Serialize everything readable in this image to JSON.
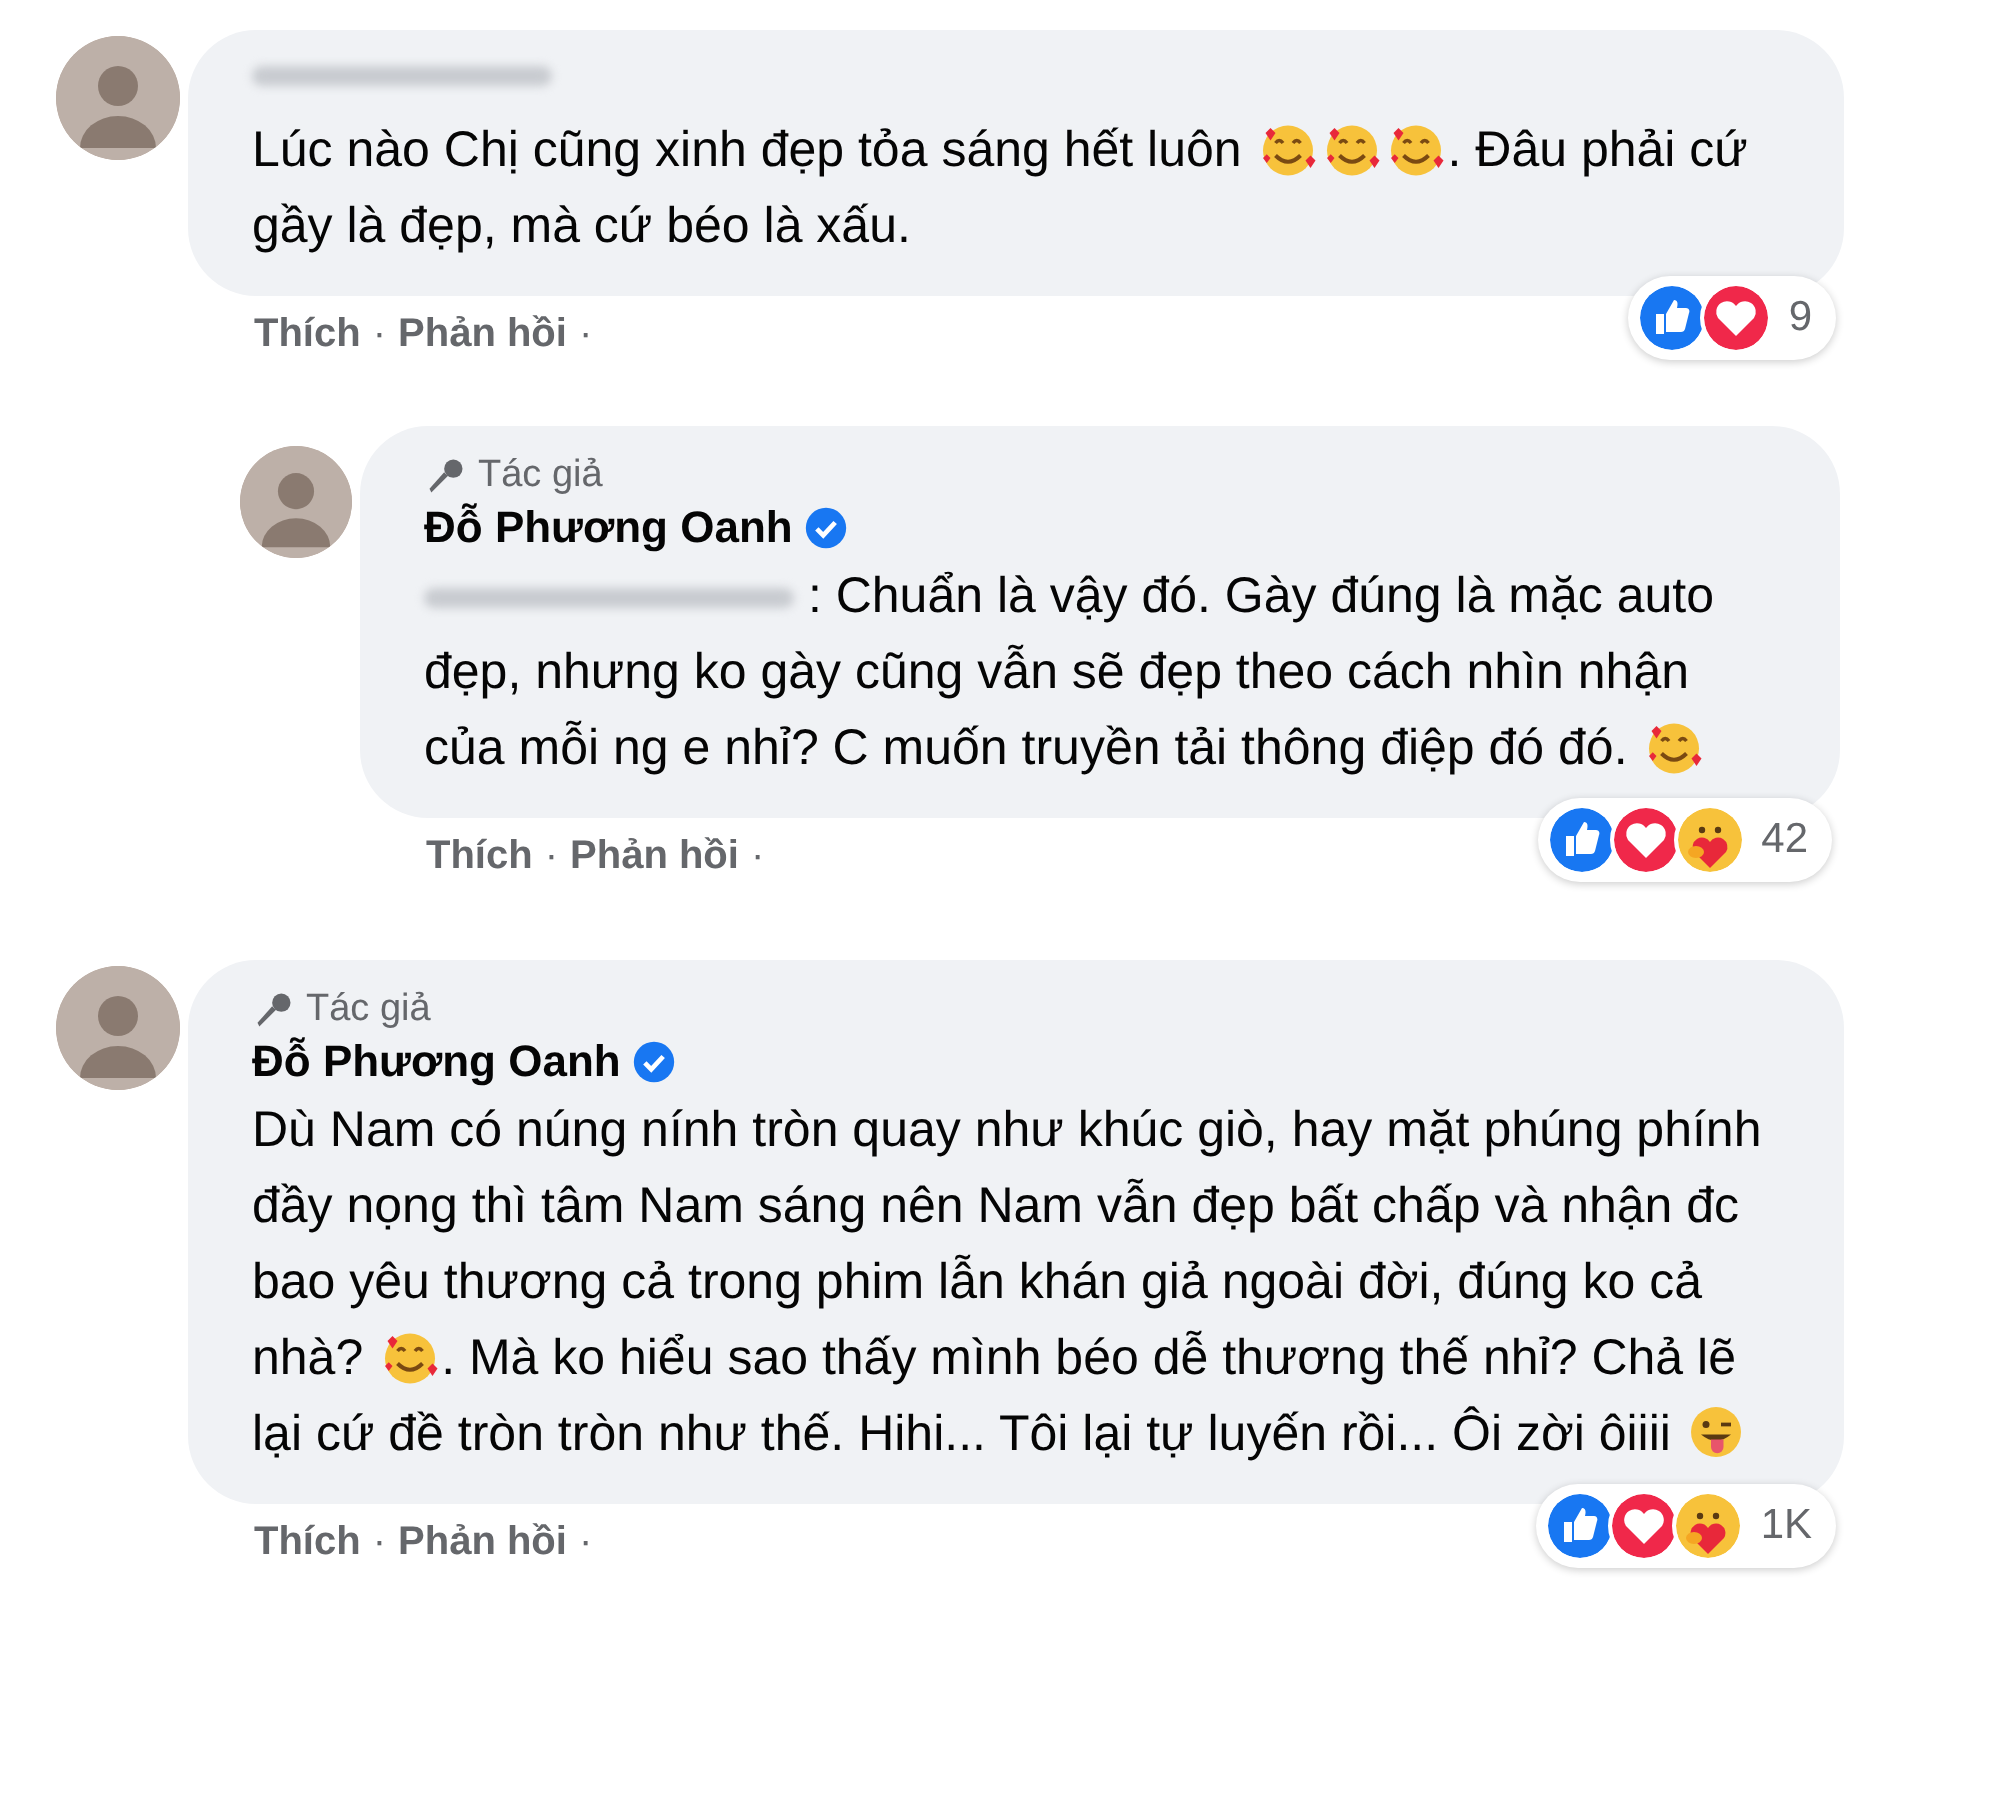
{
  "comments": [
    {
      "name_blurred": true,
      "verified": false,
      "reply": false,
      "body": [
        {
          "kind": "text",
          "text": "Lúc nào Chị cũng xinh đẹp tỏa sáng hết luôn "
        },
        {
          "kind": "hearts-emoji"
        },
        {
          "kind": "hearts-emoji"
        },
        {
          "kind": "hearts-emoji"
        },
        {
          "kind": "text",
          "text": ". Đâu phải cứ gầy là đẹp, mà cứ béo là xấu."
        }
      ],
      "reactions": [
        {
          "kind": "like"
        },
        {
          "kind": "love"
        }
      ],
      "reaction_count": "9",
      "actions": [
        {
          "kind": "link",
          "text": "Thích"
        },
        {
          "kind": "separator",
          "text": "·"
        },
        {
          "kind": "link",
          "text": "Phản hồi"
        },
        {
          "kind": "separator",
          "text": "·"
        }
      ]
    },
    {
      "name": "Đỗ Phương Oanh",
      "name_blurred": false,
      "author_badge": "Tác giả",
      "verified": true,
      "reply": true,
      "body": [
        {
          "kind": "mention"
        },
        {
          "kind": "text",
          "text": " : Chuẩn là vậy đó. Gày đúng là mặc auto đẹp, nhưng ko gày cũng vẫn sẽ đẹp theo cách nhìn nhận của mỗi ng e nhỉ? C muốn truyền tải thông điệp đó đó. "
        },
        {
          "kind": "hearts-emoji"
        }
      ],
      "reactions": [
        {
          "kind": "like"
        },
        {
          "kind": "love"
        },
        {
          "kind": "care"
        }
      ],
      "reaction_count": "42",
      "actions": [
        {
          "kind": "link",
          "text": "Thích"
        },
        {
          "kind": "separator",
          "text": "·"
        },
        {
          "kind": "link",
          "text": "Phản hồi"
        },
        {
          "kind": "separator",
          "text": "·"
        }
      ]
    },
    {
      "name": "Đỗ Phương Oanh",
      "name_blurred": false,
      "author_badge": "Tác giả",
      "verified": true,
      "reply": false,
      "body": [
        {
          "kind": "text",
          "text": "Dù Nam có núng nính tròn quay như khúc giò, hay mặt phúng phính đầy nọng thì tâm Nam sáng nên Nam vẫn đẹp bất chấp và nhận đc bao yêu thương cả trong phim lẫn khán giả ngoài đời, đúng ko cả nhà? "
        },
        {
          "kind": "hearts-emoji"
        },
        {
          "kind": "text",
          "text": ". Mà ko hiểu sao thấy mình béo dễ thương thế nhỉ? Chả lẽ lại cứ đề tròn tròn như thế. Hihi... Tôi lại tự luyến rồi... Ôi zời ôiiii "
        },
        {
          "kind": "tongue-emoji"
        }
      ],
      "reactions": [
        {
          "kind": "like"
        },
        {
          "kind": "love"
        },
        {
          "kind": "care"
        }
      ],
      "reaction_count": "1K",
      "actions": [
        {
          "kind": "link",
          "text": "Thích"
        },
        {
          "kind": "separator",
          "text": "·"
        },
        {
          "kind": "link",
          "text": "Phản hồi"
        },
        {
          "kind": "separator",
          "text": "·"
        }
      ]
    }
  ]
}
